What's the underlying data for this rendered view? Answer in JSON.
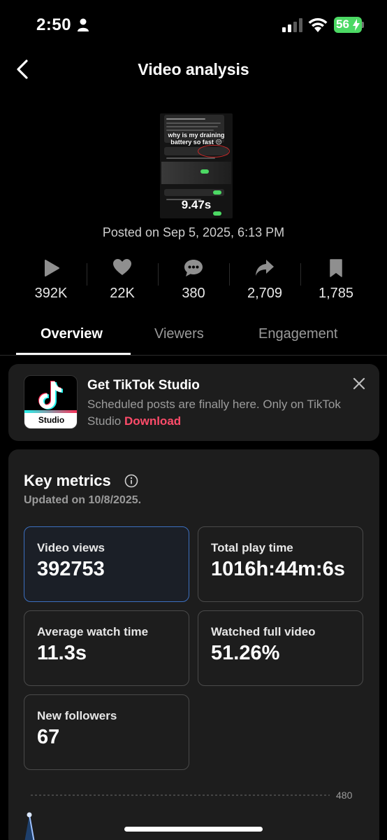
{
  "status_bar": {
    "time": "2:50",
    "battery": "56"
  },
  "header": {
    "title": "Video analysis"
  },
  "video": {
    "caption": "why is my draining battery so fast 😔",
    "duration": "9.47s",
    "posted": "Posted on Sep 5, 2025, 6:13 PM"
  },
  "stats": [
    {
      "icon": "play-icon",
      "value": "392K"
    },
    {
      "icon": "heart-icon",
      "value": "22K"
    },
    {
      "icon": "comment-icon",
      "value": "380"
    },
    {
      "icon": "share-icon",
      "value": "2,709"
    },
    {
      "icon": "bookmark-icon",
      "value": "1,785"
    }
  ],
  "tabs": [
    {
      "label": "Overview",
      "active": true
    },
    {
      "label": "Viewers",
      "active": false
    },
    {
      "label": "Engagement",
      "active": false
    }
  ],
  "promo": {
    "logo_text": "Studio",
    "title": "Get TikTok Studio",
    "text": "Scheduled posts are finally here. Only on TikTok Studio",
    "link": "Download"
  },
  "key_metrics": {
    "title": "Key metrics",
    "updated": "Updated on 10/8/2025.",
    "cards": [
      {
        "label": "Video views",
        "value": "392753",
        "selected": true
      },
      {
        "label": "Total play time",
        "value": "1016h:44m:6s",
        "selected": false
      },
      {
        "label": "Average watch time",
        "value": "11.3s",
        "selected": false
      },
      {
        "label": "Watched full video",
        "value": "51.26%",
        "selected": false
      },
      {
        "label": "New followers",
        "value": "67",
        "selected": false
      }
    ],
    "chart_max_label": "480"
  },
  "colors": {
    "accent_link": "#fe4c6a",
    "selected_border": "#3c6fbf",
    "battery": "#4cd964"
  }
}
